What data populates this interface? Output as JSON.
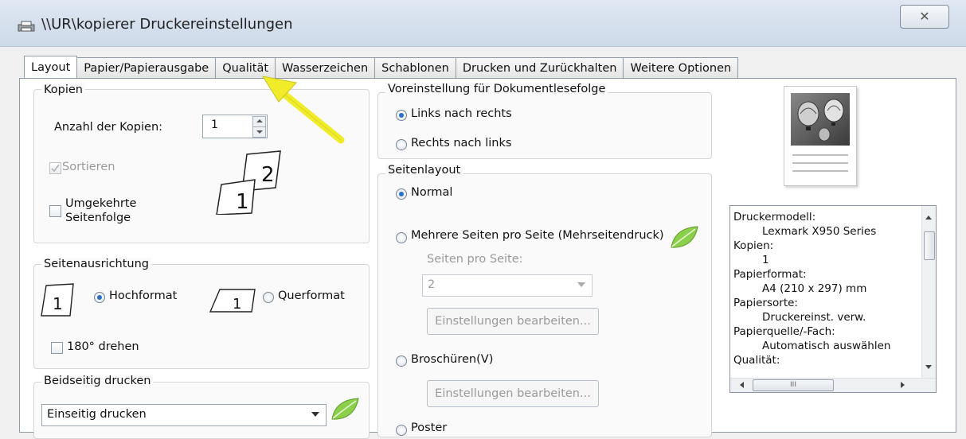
{
  "window": {
    "title": "\\\\UR\\kopierer Druckereinstellungen",
    "close_glyph": "✕"
  },
  "tabs": [
    "Layout",
    "Papier/Papierausgabe",
    "Qualität",
    "Wasserzeichen",
    "Schablonen",
    "Drucken und Zurückhalten",
    "Weitere Optionen"
  ],
  "copies": {
    "group_label": "Kopien",
    "count_label": "Anzahl der Kopien:",
    "count_value": "1",
    "collate_label": "Sortieren",
    "reverse_label_line1": "Umgekehrte",
    "reverse_label_line2": "Seitenfolge",
    "icon_num_back": "2",
    "icon_num_front": "1"
  },
  "orientation": {
    "group_label": "Seitenausrichtung",
    "portrait_label": "Hochformat",
    "landscape_label": "Querformat",
    "rotate_label": "180° drehen",
    "icon_num": "1"
  },
  "duplex": {
    "group_label": "Beidseitig drucken",
    "selected": "Einseitig drucken"
  },
  "reading_order": {
    "group_label": "Voreinstellung für Dokumentlesefolge",
    "left_to_right": "Links nach rechts",
    "right_to_left": "Rechts nach links"
  },
  "page_layout": {
    "group_label": "Seitenlayout",
    "normal": "Normal",
    "multi": "Mehrere Seiten pro Seite (Mehrseitendruck)",
    "pages_per_sheet_label": "Seiten pro Seite:",
    "pages_per_sheet_value": "2",
    "edit_button_1": "Einstellungen bearbeiten...",
    "booklet": "Broschüren(V)",
    "edit_button_2": "Einstellungen bearbeiten...",
    "poster": "Poster"
  },
  "info": {
    "lines": [
      "Druckermodell:",
      "Lexmark X950 Series",
      "Kopien:",
      "1",
      "Papierformat:",
      "A4 (210 x 297) mm",
      "Papiersorte:",
      "Druckereinst. verw.",
      "Papierquelle/-Fach:",
      "Automatisch auswählen",
      "Qualität:"
    ],
    "hscroll_glyph": "III"
  },
  "colors": {
    "accent": "#2a6fc4",
    "arrow": "#f0ec2a",
    "leaf": "#7cc240"
  }
}
